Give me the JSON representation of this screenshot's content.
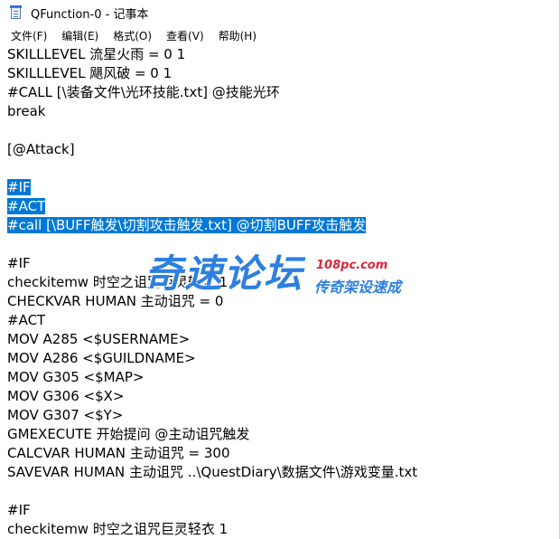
{
  "window": {
    "title": "QFunction-0 - 记事本",
    "app_icon": "notepad-icon"
  },
  "menu": [
    {
      "label": "文件(F)"
    },
    {
      "label": "编辑(E)"
    },
    {
      "label": "格式(O)"
    },
    {
      "label": "查看(V)"
    },
    {
      "label": "帮助(H)"
    }
  ],
  "editor": {
    "lines": [
      {
        "text": "SKILLLEVEL 流星火雨 = 0 1",
        "selected": false
      },
      {
        "text": "SKILLLEVEL 飓风破 = 0 1",
        "selected": false
      },
      {
        "text": "#CALL [\\装备文件\\光环技能.txt] @技能光环",
        "selected": false
      },
      {
        "text": "break",
        "selected": false
      },
      {
        "text": "",
        "selected": false
      },
      {
        "text": "[@Attack]",
        "selected": false
      },
      {
        "text": "",
        "selected": false
      },
      {
        "text": "#IF",
        "selected": true
      },
      {
        "text": "#ACT",
        "selected": true
      },
      {
        "text": "#call [\\BUFF触发\\切割攻击触发.txt] @切割BUFF攻击触发",
        "selected": true
      },
      {
        "text": "",
        "selected": false
      },
      {
        "text": "#IF",
        "selected": false
      },
      {
        "text": "checkitemw 时空之诅咒巨灵轻衣 1",
        "selected": false
      },
      {
        "text": "CHECKVAR HUMAN 主动诅咒 = 0",
        "selected": false
      },
      {
        "text": "#ACT",
        "selected": false
      },
      {
        "text": "MOV A285 <$USERNAME>",
        "selected": false
      },
      {
        "text": "MOV A286 <$GUILDNAME>",
        "selected": false
      },
      {
        "text": "MOV G305 <$MAP>",
        "selected": false
      },
      {
        "text": "MOV G306 <$X>",
        "selected": false
      },
      {
        "text": "MOV G307 <$Y>",
        "selected": false
      },
      {
        "text": "GMEXECUTE 开始提问 @主动诅咒触发",
        "selected": false
      },
      {
        "text": "CALCVAR HUMAN 主动诅咒 = 300",
        "selected": false
      },
      {
        "text": "SAVEVAR HUMAN 主动诅咒 ..\\QuestDiary\\数据文件\\游戏变量.txt",
        "selected": false
      },
      {
        "text": "",
        "selected": false
      },
      {
        "text": "#IF",
        "selected": false
      },
      {
        "text": "checkitemw 时空之诅咒巨灵轻衣 1",
        "selected": false
      }
    ],
    "selection_color": "#0078d7"
  },
  "watermark": {
    "main": "奇速论坛",
    "url": "108pc.com",
    "sub": "传奇架设速成",
    "color_main": "#2d7fe0",
    "color_url": "#d8263a"
  }
}
